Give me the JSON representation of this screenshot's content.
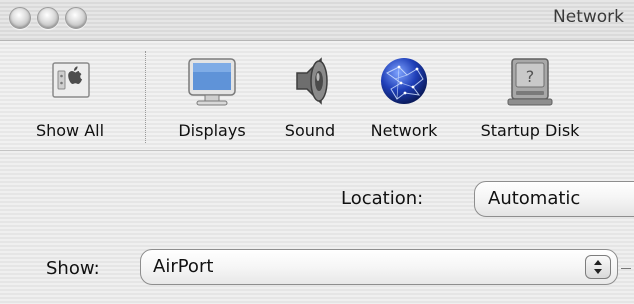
{
  "window": {
    "title": "Network"
  },
  "toolbar": {
    "items": [
      {
        "label": "Show All",
        "icon": "show-all-icon"
      },
      {
        "label": "Displays",
        "icon": "displays-icon"
      },
      {
        "label": "Sound",
        "icon": "sound-icon"
      },
      {
        "label": "Network",
        "icon": "network-globe-icon"
      },
      {
        "label": "Startup Disk",
        "icon": "startup-disk-icon"
      }
    ]
  },
  "location": {
    "label": "Location:",
    "value": "Automatic"
  },
  "show": {
    "label": "Show:",
    "value": "AirPort"
  },
  "colors": {
    "window_bg": "#ececec",
    "globe_blue": "#1f3fb8",
    "display_blue": "#5f93d8"
  }
}
